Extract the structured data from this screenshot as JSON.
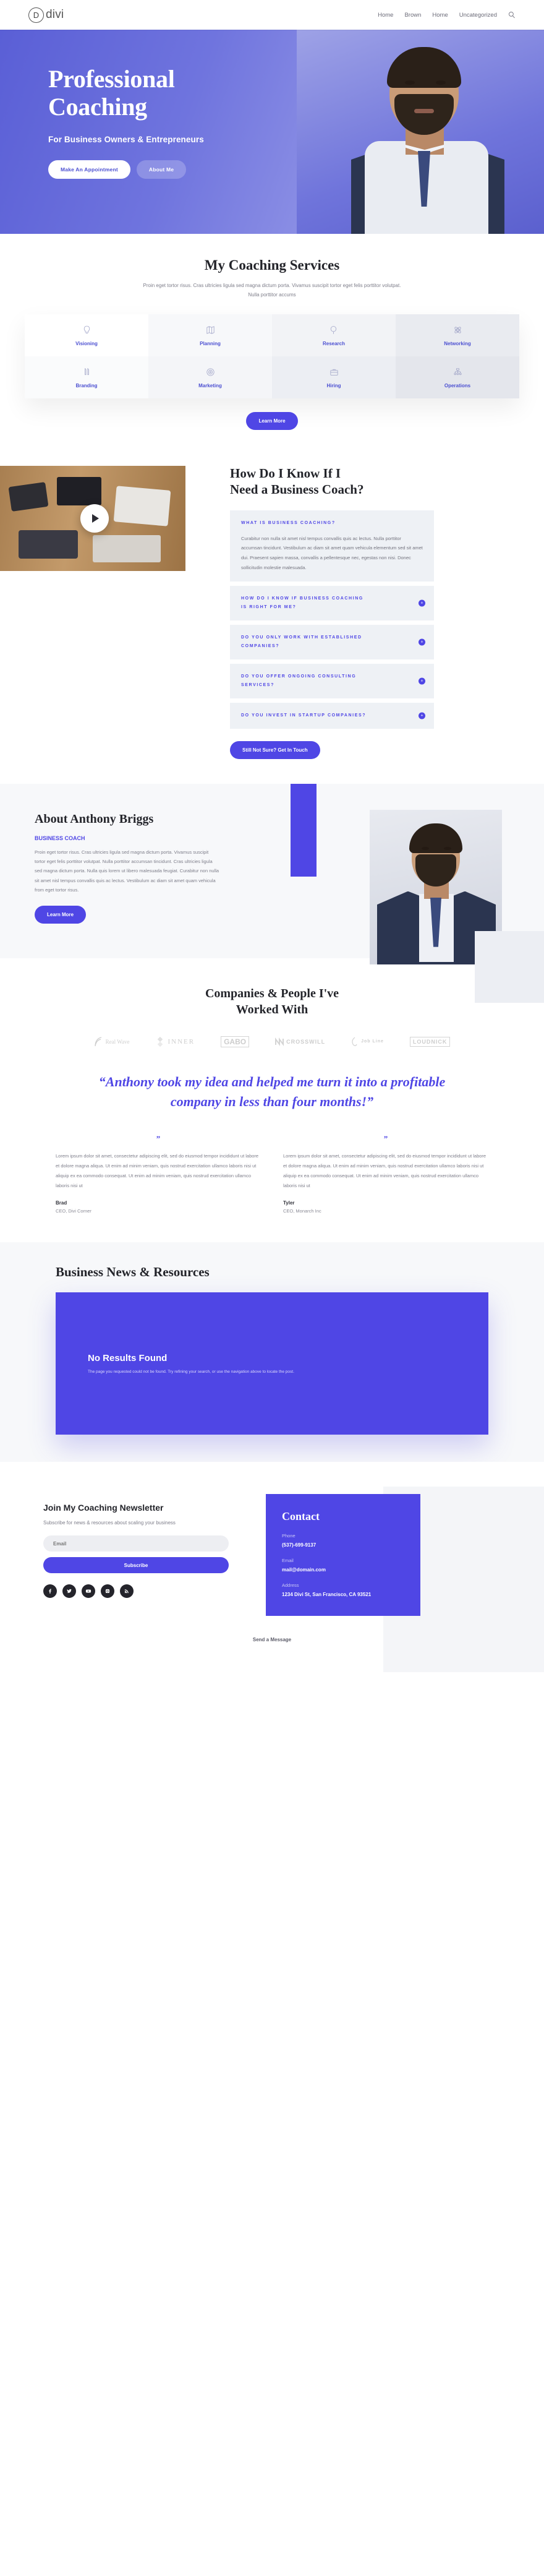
{
  "header": {
    "logo_text": "divi",
    "logo_mark": "D",
    "nav": [
      {
        "label": "Home"
      },
      {
        "label": "Brown"
      },
      {
        "label": "Home"
      },
      {
        "label": "Uncategorized"
      }
    ],
    "search_icon": "search-icon"
  },
  "hero": {
    "title_line1": "Professional",
    "title_line2": "Coaching",
    "subtitle": "For Business Owners & Entrepreneurs",
    "primary_button": "Make An Appointment",
    "secondary_button": "About Me"
  },
  "services": {
    "title": "My Coaching Services",
    "subtitle": "Proin eget tortor risus. Cras ultricies ligula sed magna dictum porta. Vivamus suscipit tortor eget felis porttitor volutpat. Nulla porttitor accums",
    "items": [
      {
        "label": "Visioning",
        "icon": "lightbulb-icon"
      },
      {
        "label": "Planning",
        "icon": "map-icon"
      },
      {
        "label": "Research",
        "icon": "magnifier-icon"
      },
      {
        "label": "Networking",
        "icon": "atom-icon"
      },
      {
        "label": "Branding",
        "icon": "pens-icon"
      },
      {
        "label": "Marketing",
        "icon": "target-icon"
      },
      {
        "label": "Hiring",
        "icon": "briefcase-icon"
      },
      {
        "label": "Operations",
        "icon": "org-chart-icon"
      }
    ],
    "learn_more": "Learn More"
  },
  "faq": {
    "heading_line1": "How Do I Know If I",
    "heading_line2": "Need a Business Coach?",
    "play_icon": "play-icon",
    "items": [
      {
        "question": "WHAT IS BUSINESS COACHING?",
        "answer": "Curabitur non nulla sit amet nisl tempus convallis quis ac lectus. Nulla porttitor accumsan tincidunt. Vestibulum ac diam sit amet quam vehicula elementum sed sit amet dui. Praesent sapien massa, convallis a pellentesque nec, egestas non nisi. Donec sollicitudin molestie malesuada.",
        "open": true
      },
      {
        "question": "HOW DO I KNOW IF BUSINESS COACHING IS RIGHT FOR ME?",
        "open": false
      },
      {
        "question": "DO YOU ONLY WORK WITH ESTABLISHED COMPANIES?",
        "open": false
      },
      {
        "question": "DO YOU OFFER ONGOING CONSULTING SERVICES?",
        "open": false
      },
      {
        "question": "DO YOU INVEST IN STARTUP COMPANIES?",
        "open": false
      }
    ],
    "cta": "Still Not Sure? Get In Touch"
  },
  "about": {
    "title": "About Anthony Briggs",
    "kicker": "BUSINESS COACH",
    "body": "Proin eget tortor risus. Cras ultricies ligula sed magna dictum porta. Vivamus suscipit tortor eget felis porttitor volutpat. Nulla porttitor accumsan tincidunt. Cras ultricies ligula sed magna dictum porta. Nulla quis lorem ut libero malesuada feugiat. Curabitur non nulla sit amet nisl tempus convallis quis ac lectus. Vestibulum ac diam sit amet quam vehicula from eget tortor risus.",
    "button": "Learn More"
  },
  "companies": {
    "title_line1": "Companies & People I've",
    "title_line2": "Worked With",
    "logos": [
      {
        "name": "Real Wave"
      },
      {
        "name": "INNER"
      },
      {
        "name": "GABO"
      },
      {
        "name": "CROSSWILL"
      },
      {
        "name": "Job Line"
      },
      {
        "name": "LOUDNICK"
      }
    ]
  },
  "testimonial_quote": "“Anthony took my idea and helped me turn it into a profitable company in less than four months!”",
  "testimonials": [
    {
      "quote_mark": "”",
      "body": "Lorem ipsum dolor sit amet, consectetur adipiscing elit, sed do eiusmod tempor incididunt ut labore et dolore magna aliqua. Ut enim ad minim veniam, quis nostrud exercitation ullamco laboris nisi ut aliquip ex ea commodo consequat. Ut enim ad minim veniam, quis nostrud exercitation ullamco laboris nisi ut",
      "name": "Brad",
      "role": "CEO, Divi Corner"
    },
    {
      "quote_mark": "”",
      "body": "Lorem ipsum dolor sit amet, consectetur adipiscing elit, sed do eiusmod tempor incididunt ut labore et dolore magna aliqua. Ut enim ad minim veniam, quis nostrud exercitation ullamco laboris nisi ut aliquip ex ea commodo consequat. Ut enim ad minim veniam, quis nostrud exercitation ullamco laboris nisi ut",
      "name": "Tyler",
      "role": "CEO, Monarch Inc"
    }
  ],
  "blog": {
    "title": "Business News & Resources",
    "no_results_title": "No Results Found",
    "no_results_text": "The page you requested could not be found. Try refining your search, or use the navigation above to locate the post."
  },
  "footer": {
    "newsletter_title": "Join My Coaching Newsletter",
    "newsletter_sub": "Subscribe for news & resources about scaling your business",
    "email_placeholder": "Email",
    "subscribe_label": "Subscribe",
    "socials": [
      {
        "name": "facebook-icon"
      },
      {
        "name": "twitter-icon"
      },
      {
        "name": "youtube-icon"
      },
      {
        "name": "instagram-icon"
      },
      {
        "name": "rss-icon"
      }
    ],
    "contact_title": "Contact",
    "phone_label": "Phone",
    "phone_value": "(537)-699-9137",
    "email_label": "Email",
    "email_value": "mail@domain.com",
    "address_label": "Address",
    "address_value": "1234 Divi St, San Francisco, CA 93521",
    "send_message": "Send a Message"
  },
  "colors": {
    "accent": "#4f46e5",
    "hero_gradient_start": "#5a5fd6",
    "hero_gradient_end": "#b0b2ee",
    "panel_bg": "#eef1f5"
  }
}
